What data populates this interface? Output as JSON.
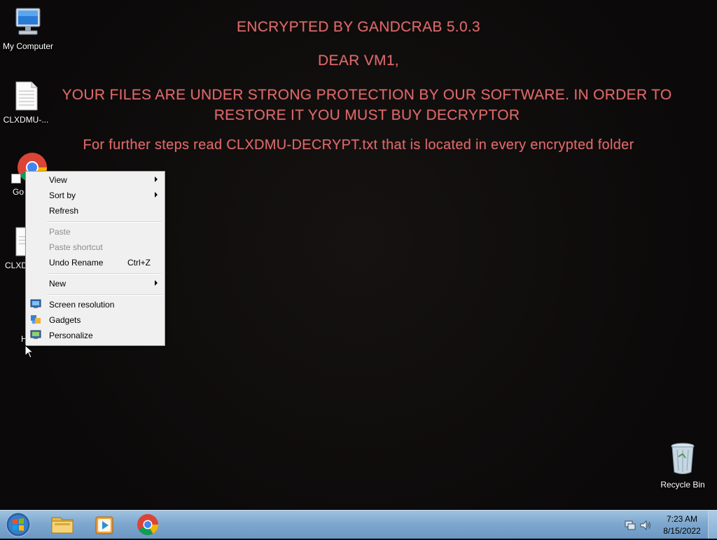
{
  "desktop": {
    "icons": [
      {
        "label": "My Computer"
      },
      {
        "label": "CLXDMU-..."
      },
      {
        "label": "Go Chr"
      },
      {
        "label": "CLXD"
      },
      {
        "label": "H"
      },
      {
        "label": "Recycle Bin"
      }
    ]
  },
  "ransom_note": {
    "title": "ENCRYPTED BY GANDCRAB 5.0.3",
    "greeting": "DEAR VM1,",
    "message": "YOUR FILES ARE UNDER STRONG PROTECTION BY OUR SOFTWARE. IN ORDER TO RESTORE IT YOU MUST BUY DECRYPTOR",
    "instructions": "For further steps read CLXDMU-DECRYPT.txt that is located in every encrypted folder",
    "text_color": "#d96a6a"
  },
  "context_menu": {
    "view": "View",
    "sort_by": "Sort by",
    "refresh": "Refresh",
    "paste": "Paste",
    "paste_shortcut": "Paste shortcut",
    "undo_rename": "Undo Rename",
    "undo_rename_shortcut": "Ctrl+Z",
    "new": "New",
    "screen_resolution": "Screen resolution",
    "gadgets": "Gadgets",
    "personalize": "Personalize"
  },
  "taskbar": {
    "time": "7:23 AM",
    "date": "8/15/2022",
    "pinned": [
      "windows-explorer-icon",
      "media-player-icon",
      "chrome-icon"
    ]
  }
}
